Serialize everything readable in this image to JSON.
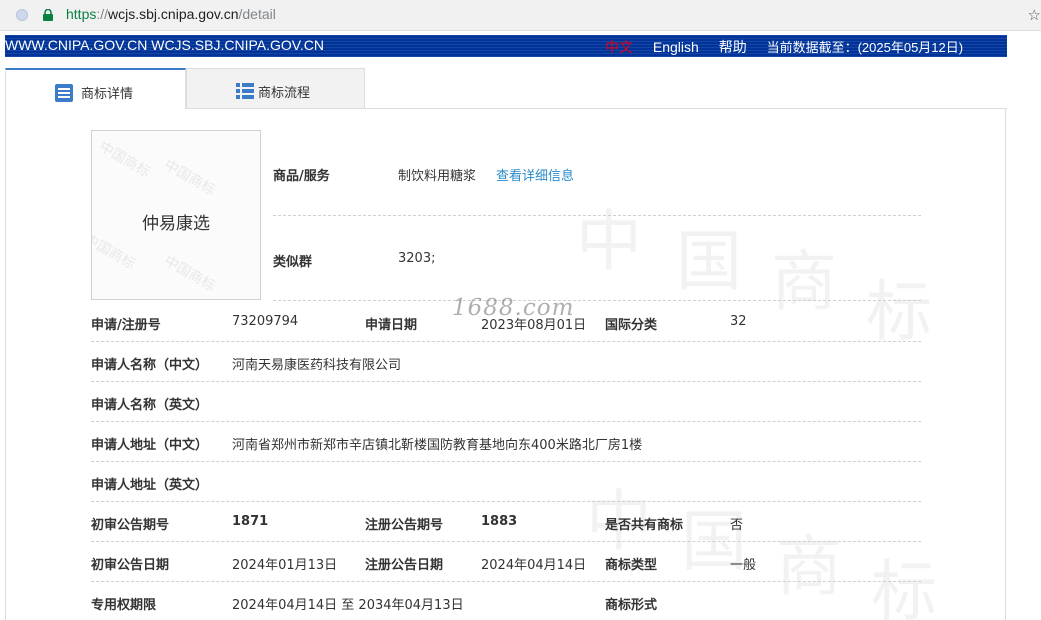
{
  "browser": {
    "url_scheme": "https",
    "url_sep": "://",
    "url_host": "wcjs.sbj.cnipa.gov.cn",
    "url_path": "/detail"
  },
  "banner": {
    "site": "WWW.CNIPA.GOV.CN WCJS.SBJ.CNIPA.GOV.CN",
    "lang_cn": "中文",
    "lang_en": "English",
    "help": "帮助",
    "data_date": "当前数据截至：(2025年05月12日)"
  },
  "tabs": [
    {
      "label": "商标详情",
      "icon": "list-icon"
    },
    {
      "label": "商标流程",
      "icon": "flow-list-icon"
    }
  ],
  "trademark": {
    "image_text": "仲易康选",
    "goods_label": "商品/服务",
    "goods_value": "制饮料用糖浆",
    "goods_link": "查看详细信息",
    "similar_group_label": "类似群",
    "similar_group_value": "3203;"
  },
  "details": {
    "reg_no_label": "申请/注册号",
    "reg_no": "73209794",
    "app_date_label": "申请日期",
    "app_date": "2023年08月01日",
    "intl_class_label": "国际分类",
    "intl_class": "32",
    "applicant_cn_label": "申请人名称（中文）",
    "applicant_cn": "河南天易康医药科技有限公司",
    "applicant_en_label": "申请人名称（英文）",
    "applicant_en": "",
    "address_cn_label": "申请人地址（中文）",
    "address_cn": "河南省郑州市新郑市辛店镇北靳楼国防教育基地向东400米路北厂房1楼",
    "address_en_label": "申请人地址（英文）",
    "address_en": "",
    "prelim_no_label": "初审公告期号",
    "prelim_no": "1871",
    "reg_pub_no_label": "注册公告期号",
    "reg_pub_no": "1883",
    "shared_label": "是否共有商标",
    "shared": "否",
    "prelim_date_label": "初审公告日期",
    "prelim_date": "2024年01月13日",
    "reg_pub_date_label": "注册公告日期",
    "reg_pub_date": "2024年04月14日",
    "tm_type_label": "商标类型",
    "tm_type": "一般",
    "term_label": "专用权期限",
    "term": "2024年04月14日 至 2034年04月13日",
    "tm_form_label": "商标形式",
    "tm_form": ""
  },
  "watermark": {
    "overlay": "1688.com",
    "chars": [
      "中",
      "国",
      "商",
      "标"
    ],
    "image_wm": "中国商标"
  },
  "colors": {
    "banner_bg": "#003399",
    "link": "#2a8bcc",
    "lang_active": "#e60012",
    "tab_active_border": "#3b7bc7"
  }
}
